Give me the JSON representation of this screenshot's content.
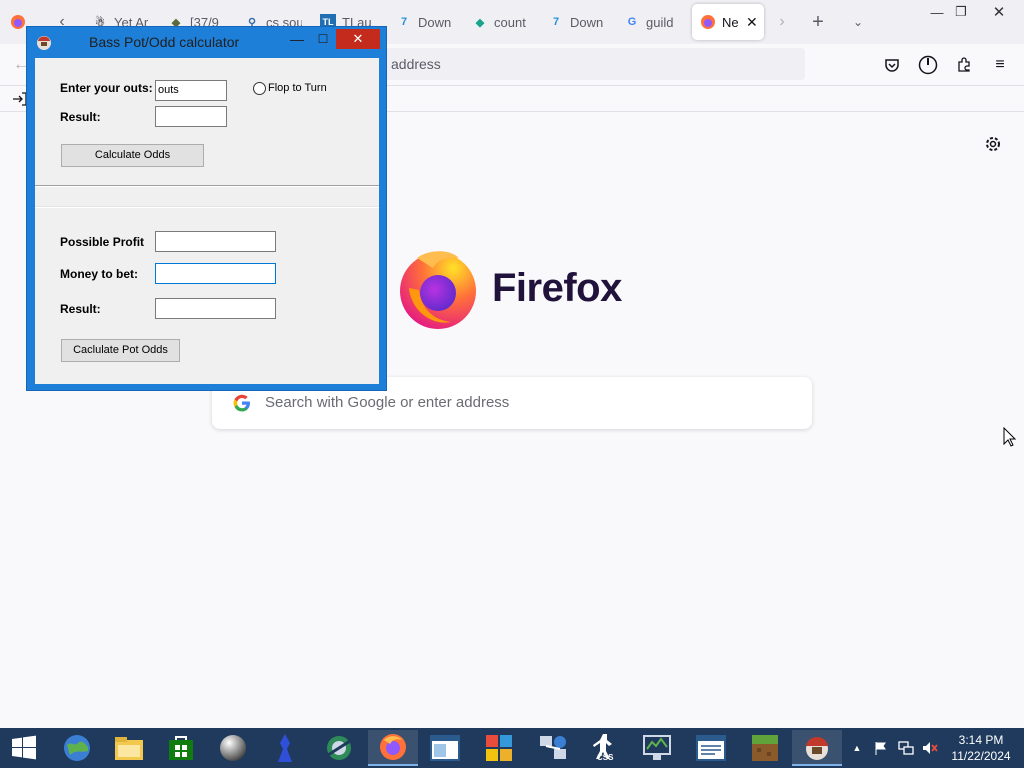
{
  "browser": {
    "tabs": [
      {
        "title": "Yet Ar",
        "icon": "user-icon"
      },
      {
        "title": "[37/9",
        "icon": "tag-icon"
      },
      {
        "title": "cs sou",
        "icon": "search-icon"
      },
      {
        "title": "TLau",
        "icon": "tl-icon"
      },
      {
        "title": "Down",
        "icon": "download-site-icon"
      },
      {
        "title": "count",
        "icon": "leaf-icon"
      },
      {
        "title": "Down",
        "icon": "download-site-icon"
      },
      {
        "title": "guild",
        "icon": "google-icon"
      },
      {
        "title": "Ne",
        "icon": "firefox-icon",
        "active": true
      }
    ],
    "url_placeholder": "address",
    "brand_name": "Firefox",
    "search_placeholder": "Search with Google or enter address"
  },
  "dialog": {
    "title": "Bass Pot/Odd calculator",
    "close_glyph": "✕",
    "odds": {
      "outs_label": "Enter your outs:",
      "outs_value": "outs",
      "radio_label": "Flop to Turn",
      "result_label": "Result:",
      "result_value": "",
      "button_label": "Calculate Odds"
    },
    "pot": {
      "profit_label": "Possible Profit",
      "profit_value": "",
      "bet_label": "Money to bet:",
      "bet_value": "",
      "result_label": "Result:",
      "result_value": "",
      "button_label": "Caclulate Pot Odds"
    }
  },
  "taskbar": {
    "apps": [
      "globe-icon",
      "file-explorer-icon",
      "store-icon",
      "sphere-icon",
      "blue-figure-icon",
      "network-globe-icon",
      "firefox-icon",
      "window-app-icon",
      "colored-blocks-icon",
      "network-icon",
      "counter-strike-icon",
      "monitor-app-icon",
      "document-app-icon",
      "minecraft-icon",
      "helmet-app-icon"
    ],
    "active_app_index": 6,
    "css_label": "CSS",
    "time": "3:14 PM",
    "date": "11/22/2024"
  },
  "colors": {
    "dialog_frame": "#1e7fd9",
    "close_button": "#c42b1c",
    "taskbar": "#1f3a5c",
    "firefox_wordmark": "#20123a"
  }
}
